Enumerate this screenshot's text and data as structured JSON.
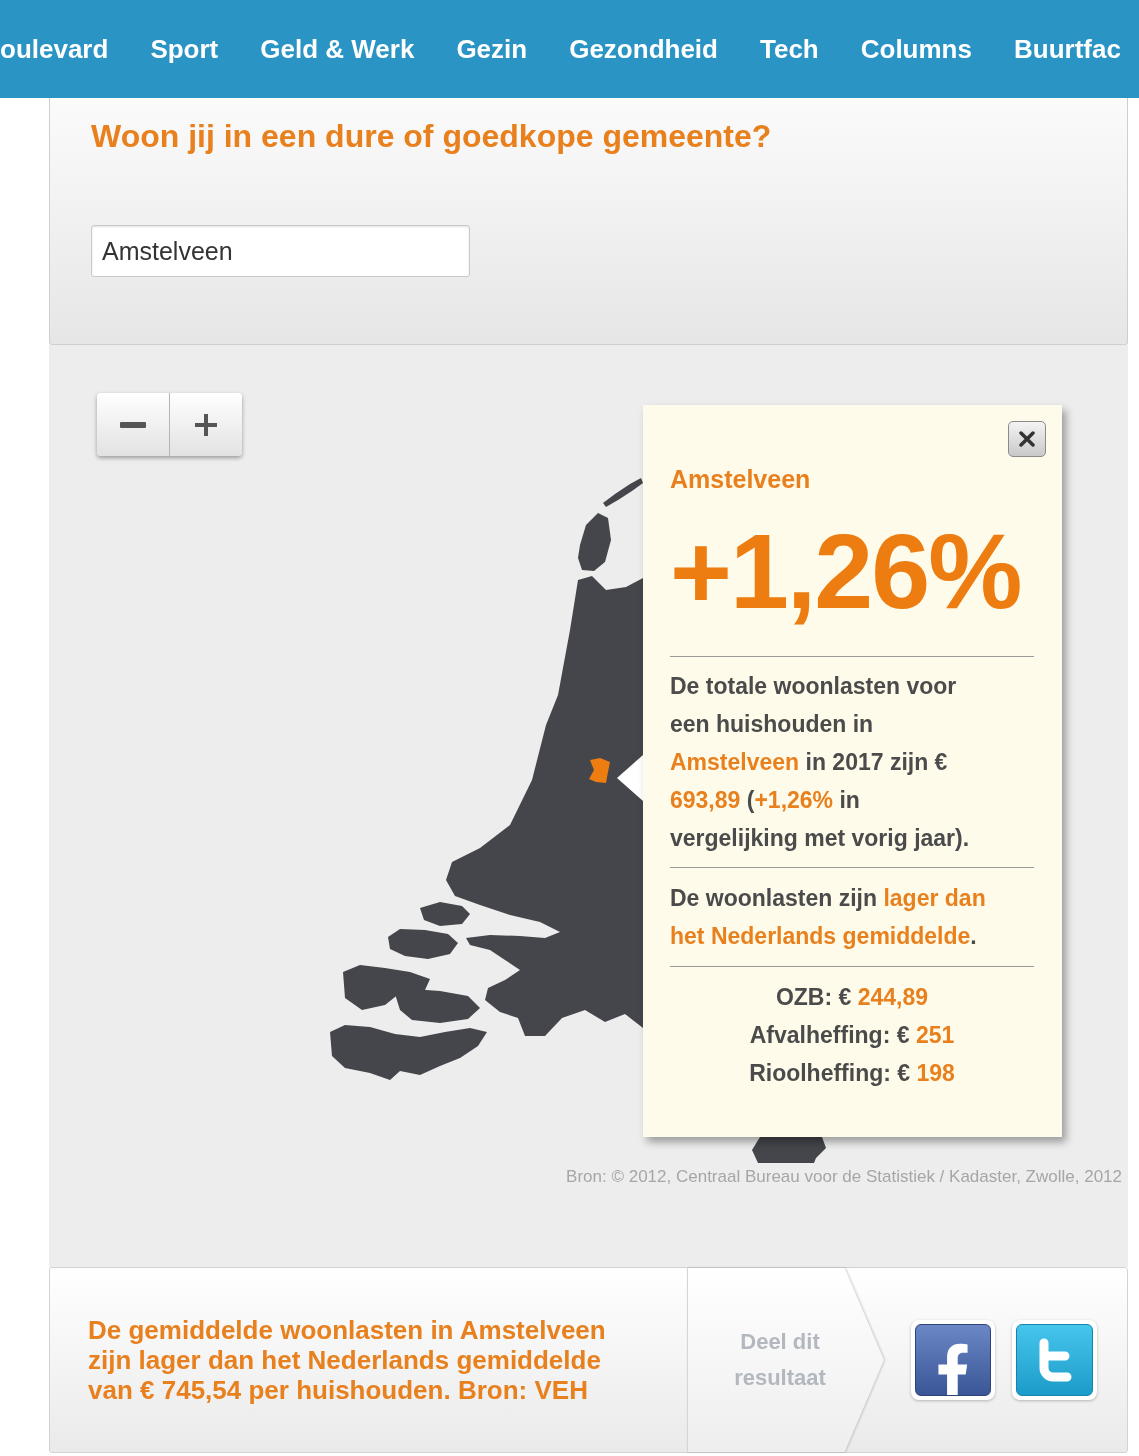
{
  "navigation": [
    "oulevard",
    "Sport",
    "Geld & Werk",
    "Gezin",
    "Gezondheid",
    "Tech",
    "Columns",
    "Buurtfac"
  ],
  "search_panel": {
    "title": "Woon jij in een dure of goedkope gemeente?",
    "search_field": {
      "value": "Amstelveen"
    }
  },
  "map": {
    "popup": {
      "municipality": "Amstelveen",
      "change": "+1,26%",
      "summary": [
        {
          "text": "De totale woonlasten voor een huishouden in ",
          "highlight": false
        },
        {
          "text": "Amstelveen",
          "highlight": true
        },
        {
          "text": " in 2017 zijn € ",
          "highlight": false
        },
        {
          "text": "693,89",
          "highlight": true
        },
        {
          "text": " (",
          "highlight": false
        },
        {
          "text": "+1,26%",
          "highlight": true
        },
        {
          "text": " in vergelijking met vorig jaar).",
          "highlight": false
        }
      ],
      "comparison": [
        {
          "text": "De woonlasten zijn ",
          "highlight": false
        },
        {
          "text": "lager dan het Nederlands gemiddelde",
          "highlight": true
        },
        {
          "text": ".",
          "highlight": false
        }
      ],
      "fees": [
        {
          "label": "OZB: €",
          "amount": "244,89"
        },
        {
          "label": "Afvalheffing: €",
          "amount": "251"
        },
        {
          "label": "Rioolheffing: €",
          "amount": "198"
        }
      ]
    },
    "source": "Bron: © 2012, Centraal Bureau voor de Statistiek / Kadaster, Zwolle, 2012"
  },
  "share_bar": {
    "message": "De gemiddelde woonlasten in Amstelveen zijn lager dan het Nederlands gemiddelde van € 745,54 per huishouden. Bron: VEH",
    "share_label": "Deel dit resultaat"
  }
}
